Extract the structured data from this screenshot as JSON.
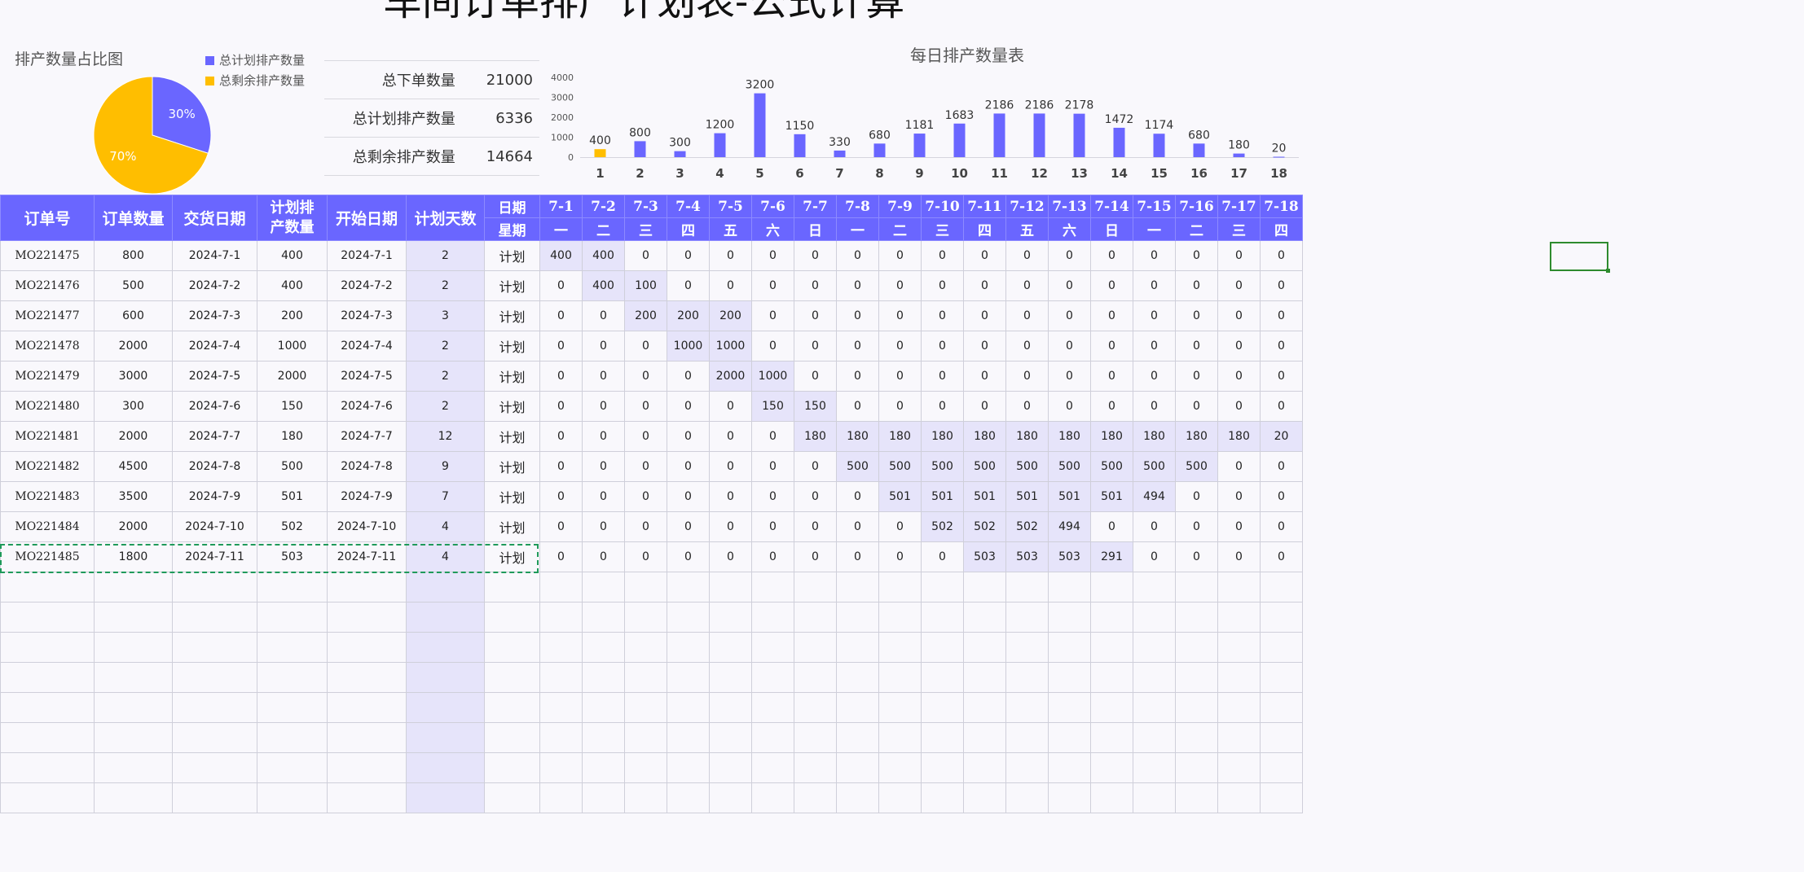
{
  "sheet": {
    "title": "车间订单排产计划表-公式计算"
  },
  "pie": {
    "title": "排产数量占比图",
    "legend": [
      "总计划排产数量",
      "总剩余排产数量"
    ],
    "colors": [
      "#6a66ff",
      "#ffbe00"
    ],
    "chart_data": {
      "type": "pie",
      "categories": [
        "总计划排产数量",
        "总剩余排产数量"
      ],
      "values": [
        30,
        70
      ],
      "labels": [
        "30%",
        "70%"
      ]
    }
  },
  "summary": [
    {
      "label": "总下单数量",
      "value": "21000"
    },
    {
      "label": "总计划排产数量",
      "value": "6336"
    },
    {
      "label": "总剩余排产数量",
      "value": "14664"
    }
  ],
  "bar": {
    "title": "每日排产数量表",
    "colors": {
      "normal": "#6a66ff",
      "highlight": "#ffbe00"
    },
    "chart_data": {
      "type": "bar",
      "categories": [
        "1",
        "2",
        "3",
        "4",
        "5",
        "6",
        "7",
        "8",
        "9",
        "10",
        "11",
        "12",
        "13",
        "14",
        "15",
        "16",
        "17",
        "18"
      ],
      "values": [
        400,
        800,
        300,
        1200,
        3200,
        1150,
        330,
        680,
        1181,
        1683,
        2186,
        2186,
        2178,
        1472,
        1174,
        680,
        180,
        20
      ],
      "ylim": [
        0,
        4000
      ],
      "yticks": [
        "4000",
        "3000",
        "2000",
        "1000",
        "0"
      ],
      "highlight_index": 0
    }
  },
  "table": {
    "headers": {
      "order_id": "订单号",
      "order_qty": "订单数量",
      "delivery_date": "交货日期",
      "plan_qty": "计划排产数量",
      "start_date": "开始日期",
      "plan_days": "计划天数",
      "date_label": "日期",
      "weekday_label": "星期"
    },
    "dates": [
      "7-1",
      "7-2",
      "7-3",
      "7-4",
      "7-5",
      "7-6",
      "7-7",
      "7-8",
      "7-9",
      "7-10",
      "7-11",
      "7-12",
      "7-13",
      "7-14",
      "7-15",
      "7-16",
      "7-17",
      "7-18"
    ],
    "weekdays": [
      "一",
      "二",
      "三",
      "四",
      "五",
      "六",
      "日",
      "一",
      "二",
      "三",
      "四",
      "五",
      "六",
      "日",
      "一",
      "二",
      "三",
      "四"
    ],
    "rows": [
      {
        "id": "MO221475",
        "qty": "800",
        "delivery": "2024-7-1",
        "plan": "400",
        "start": "2024-7-1",
        "days": "2",
        "type": "计划",
        "daily": [
          "400",
          "400",
          "0",
          "0",
          "0",
          "0",
          "0",
          "0",
          "0",
          "0",
          "0",
          "0",
          "0",
          "0",
          "0",
          "0",
          "0",
          "0"
        ]
      },
      {
        "id": "MO221476",
        "qty": "500",
        "delivery": "2024-7-2",
        "plan": "400",
        "start": "2024-7-2",
        "days": "2",
        "type": "计划",
        "daily": [
          "0",
          "400",
          "100",
          "0",
          "0",
          "0",
          "0",
          "0",
          "0",
          "0",
          "0",
          "0",
          "0",
          "0",
          "0",
          "0",
          "0",
          "0"
        ]
      },
      {
        "id": "MO221477",
        "qty": "600",
        "delivery": "2024-7-3",
        "plan": "200",
        "start": "2024-7-3",
        "days": "3",
        "type": "计划",
        "daily": [
          "0",
          "0",
          "200",
          "200",
          "200",
          "0",
          "0",
          "0",
          "0",
          "0",
          "0",
          "0",
          "0",
          "0",
          "0",
          "0",
          "0",
          "0"
        ]
      },
      {
        "id": "MO221478",
        "qty": "2000",
        "delivery": "2024-7-4",
        "plan": "1000",
        "start": "2024-7-4",
        "days": "2",
        "type": "计划",
        "daily": [
          "0",
          "0",
          "0",
          "1000",
          "1000",
          "0",
          "0",
          "0",
          "0",
          "0",
          "0",
          "0",
          "0",
          "0",
          "0",
          "0",
          "0",
          "0"
        ]
      },
      {
        "id": "MO221479",
        "qty": "3000",
        "delivery": "2024-7-5",
        "plan": "2000",
        "start": "2024-7-5",
        "days": "2",
        "type": "计划",
        "daily": [
          "0",
          "0",
          "0",
          "0",
          "2000",
          "1000",
          "0",
          "0",
          "0",
          "0",
          "0",
          "0",
          "0",
          "0",
          "0",
          "0",
          "0",
          "0"
        ]
      },
      {
        "id": "MO221480",
        "qty": "300",
        "delivery": "2024-7-6",
        "plan": "150",
        "start": "2024-7-6",
        "days": "2",
        "type": "计划",
        "daily": [
          "0",
          "0",
          "0",
          "0",
          "0",
          "150",
          "150",
          "0",
          "0",
          "0",
          "0",
          "0",
          "0",
          "0",
          "0",
          "0",
          "0",
          "0"
        ]
      },
      {
        "id": "MO221481",
        "qty": "2000",
        "delivery": "2024-7-7",
        "plan": "180",
        "start": "2024-7-7",
        "days": "12",
        "type": "计划",
        "daily": [
          "0",
          "0",
          "0",
          "0",
          "0",
          "0",
          "180",
          "180",
          "180",
          "180",
          "180",
          "180",
          "180",
          "180",
          "180",
          "180",
          "180",
          "20"
        ]
      },
      {
        "id": "MO221482",
        "qty": "4500",
        "delivery": "2024-7-8",
        "plan": "500",
        "start": "2024-7-8",
        "days": "9",
        "type": "计划",
        "daily": [
          "0",
          "0",
          "0",
          "0",
          "0",
          "0",
          "0",
          "500",
          "500",
          "500",
          "500",
          "500",
          "500",
          "500",
          "500",
          "500",
          "0",
          "0"
        ]
      },
      {
        "id": "MO221483",
        "qty": "3500",
        "delivery": "2024-7-9",
        "plan": "501",
        "start": "2024-7-9",
        "days": "7",
        "type": "计划",
        "daily": [
          "0",
          "0",
          "0",
          "0",
          "0",
          "0",
          "0",
          "0",
          "501",
          "501",
          "501",
          "501",
          "501",
          "501",
          "494",
          "0",
          "0",
          "0"
        ]
      },
      {
        "id": "MO221484",
        "qty": "2000",
        "delivery": "2024-7-10",
        "plan": "502",
        "start": "2024-7-10",
        "days": "4",
        "type": "计划",
        "daily": [
          "0",
          "0",
          "0",
          "0",
          "0",
          "0",
          "0",
          "0",
          "0",
          "502",
          "502",
          "502",
          "494",
          "0",
          "0",
          "0",
          "0",
          "0"
        ]
      },
      {
        "id": "MO221485",
        "qty": "1800",
        "delivery": "2024-7-11",
        "plan": "503",
        "start": "2024-7-11",
        "days": "4",
        "type": "计划",
        "daily": [
          "0",
          "0",
          "0",
          "0",
          "0",
          "0",
          "0",
          "0",
          "0",
          "0",
          "503",
          "503",
          "503",
          "291",
          "0",
          "0",
          "0",
          "0"
        ]
      }
    ],
    "empty_row_count": 8
  }
}
